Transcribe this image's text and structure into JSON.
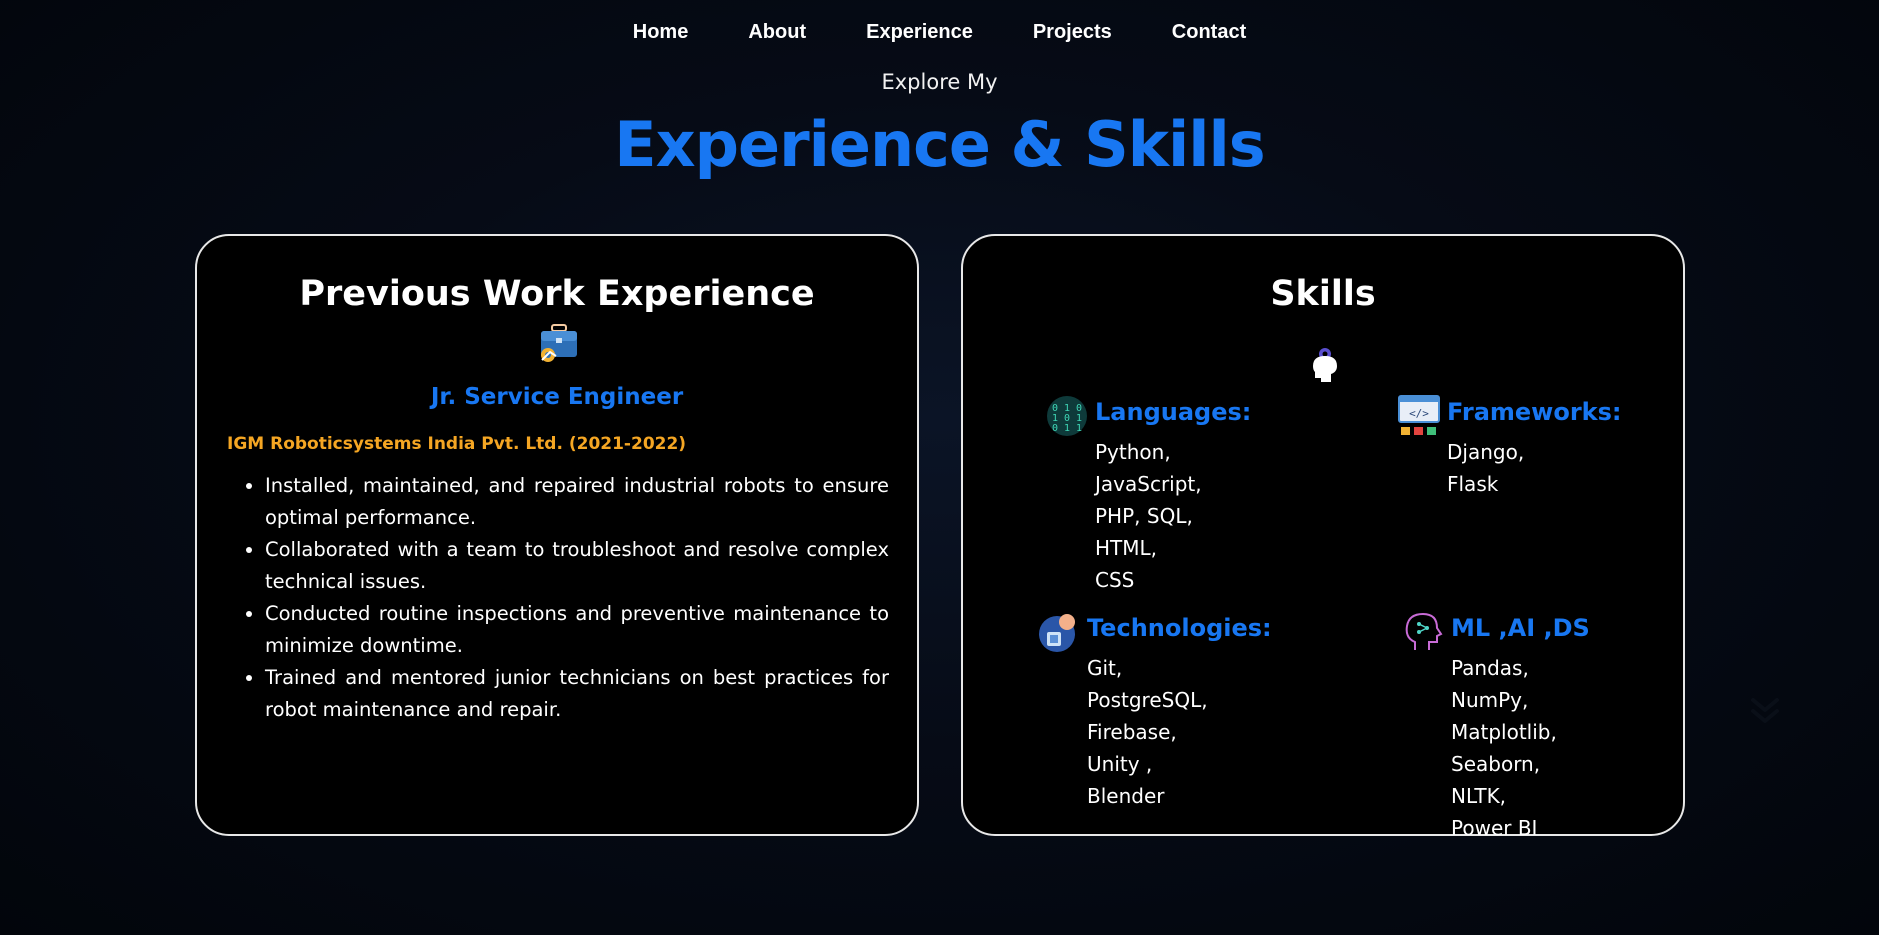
{
  "nav": {
    "items": [
      "Home",
      "About",
      "Experience",
      "Projects",
      "Contact"
    ]
  },
  "header": {
    "subtitle": "Explore My",
    "title": "Experience & Skills"
  },
  "experience": {
    "title": "Previous Work Experience",
    "icon": "briefcase-gear-icon",
    "role": "Jr. Service Engineer",
    "company": "IGM Roboticsystems India Pvt. Ltd. (2021-2022)",
    "duties": [
      "Installed, maintained, and repaired industrial robots to ensure optimal performance.",
      "Collaborated with a team to troubleshoot and resolve complex technical issues.",
      "Conducted routine inspections and preventive maintenance to minimize downtime.",
      "Trained and mentored junior technicians on best practices for robot maintenance and repair."
    ]
  },
  "skills": {
    "title": "Skills",
    "icon": "brain-gear-icon",
    "languages": {
      "label": "Languages:",
      "lines": [
        "Python,",
        "JavaScript,",
        "PHP, SQL, HTML,",
        "CSS"
      ],
      "icon": "binary-code-icon"
    },
    "frameworks": {
      "label": "Frameworks:",
      "lines": [
        "Django, Flask"
      ],
      "icon": "web-code-icon"
    },
    "technologies": {
      "label": "Technologies:",
      "lines": [
        "Git, PostgreSQL,",
        "Firebase, Unity ,",
        "Blender"
      ],
      "icon": "technology-icon"
    },
    "ml": {
      "label": "ML ,AI ,DS",
      "lines": [
        "Pandas,",
        "NumPy,",
        "Matplotlib,",
        "Seaborn, NLTK,",
        "Power BI"
      ],
      "icon": "ai-head-icon"
    }
  },
  "scroll": {
    "icon": "chevron-double-down-icon"
  },
  "colors": {
    "accent": "#1877f2",
    "company": "#f5a623",
    "card_bg": "#000000",
    "card_border": "#e8e8e8"
  }
}
